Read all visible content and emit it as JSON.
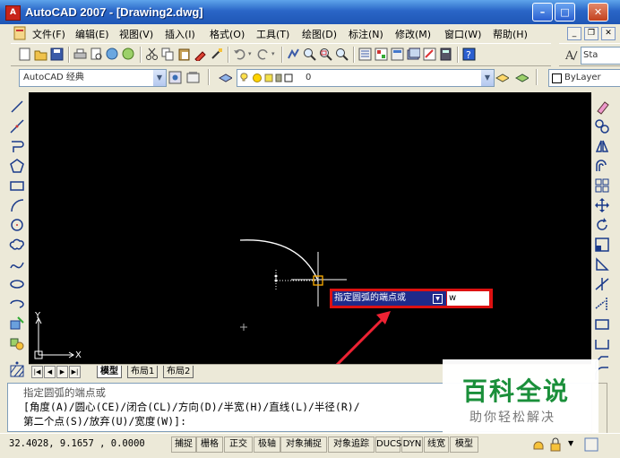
{
  "window": {
    "title": "AutoCAD 2007 - [Drawing2.dwg]",
    "app_icon": "autocad-logo-icon"
  },
  "menu": [
    "文件(F)",
    "编辑(E)",
    "视图(V)",
    "插入(I)",
    "格式(O)",
    "工具(T)",
    "绘图(D)",
    "标注(N)",
    "修改(M)",
    "窗口(W)",
    "帮助(H)"
  ],
  "toolbar2": {
    "workspace": "AutoCAD 经典",
    "layer": "0",
    "linetype": "ByLayer",
    "style_partial": "Sta"
  },
  "layout_tabs": [
    "模型",
    "布局1",
    "布局2"
  ],
  "ucs": {
    "y": "Y",
    "x": "X"
  },
  "dynamic_input": {
    "prompt": "指定圆弧的端点或",
    "value": "w"
  },
  "command_lines": [
    "指定圆弧的端点或",
    "[角度(A)/圆心(CE)/闭合(CL)/方向(D)/半宽(H)/直线(L)/半径(R)/",
    "第二个点(S)/放弃(U)/宽度(W)]:"
  ],
  "status": {
    "coords": "32.4028, 9.1657 , 0.0000",
    "buttons": [
      "捕捉",
      "栅格",
      "正交",
      "极轴",
      "对象捕捉",
      "对象追踪",
      "DUCS",
      "DYN",
      "线宽",
      "模型"
    ]
  },
  "watermark": {
    "title": "百科全说",
    "subtitle": "助你轻松解决"
  },
  "colors": {
    "title_bar": "#2a66c7",
    "drawing_bg": "#000000",
    "dyn_label_bg": "#1f2a8a",
    "highlight": "#dd1111",
    "watermark": "#1a8f3a"
  }
}
